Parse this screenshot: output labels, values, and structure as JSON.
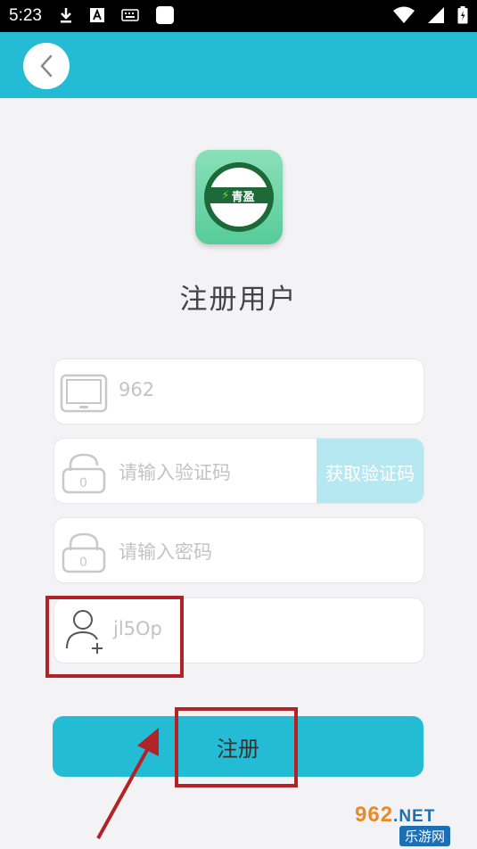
{
  "status_bar": {
    "time": "5:23"
  },
  "header": {
    "back_label": "back"
  },
  "app": {
    "logo_text": "青盈"
  },
  "page": {
    "title": "注册用户"
  },
  "form": {
    "phone": {
      "value": "962"
    },
    "verify_code": {
      "placeholder": "请输入验证码",
      "button_label": "获取验证码"
    },
    "password": {
      "placeholder": "请输入密码"
    },
    "invite": {
      "value": "jl5Op"
    },
    "submit_label": "注册"
  },
  "watermark": {
    "top": "962",
    "net": ".NET",
    "bottom": "乐游网"
  },
  "colors": {
    "accent": "#24bcd4",
    "highlight": "#b32226"
  }
}
